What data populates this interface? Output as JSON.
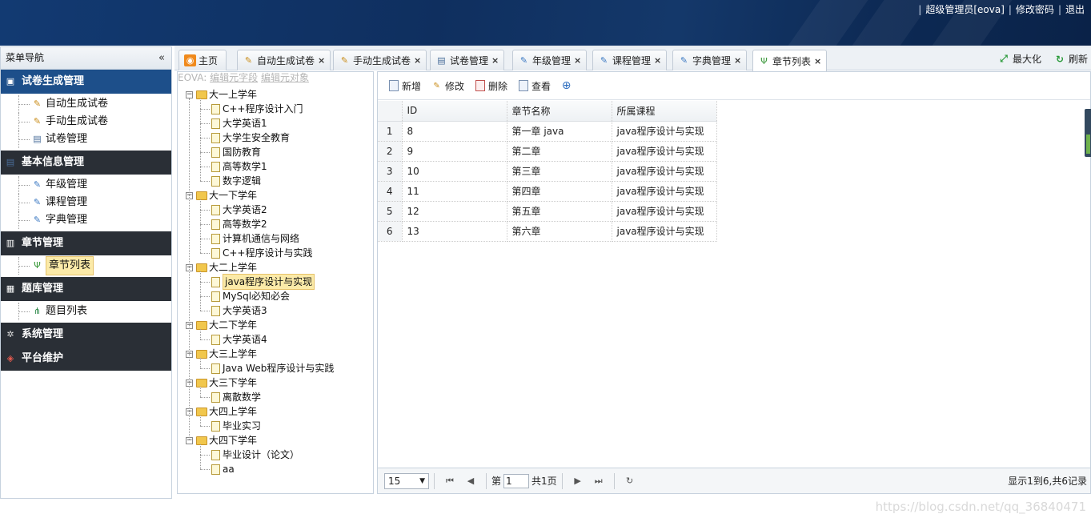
{
  "header": {
    "links": [
      "超级管理员[eova]",
      "修改密码",
      "退出"
    ]
  },
  "menu": {
    "title": "菜单导航",
    "collapse_icon": "«",
    "groups": [
      {
        "label": "试卷生成管理",
        "icon": "book-icon",
        "active": true,
        "items": [
          {
            "label": "自动生成试卷",
            "icon": "edit-icon"
          },
          {
            "label": "手动生成试卷",
            "icon": "edit-icon"
          },
          {
            "label": "试卷管理",
            "icon": "form-icon"
          }
        ]
      },
      {
        "label": "基本信息管理",
        "icon": "form-icon",
        "items": [
          {
            "label": "年级管理",
            "icon": "form-edit-icon"
          },
          {
            "label": "课程管理",
            "icon": "form-edit-icon"
          },
          {
            "label": "字典管理",
            "icon": "form-edit-icon"
          }
        ]
      },
      {
        "label": "章节管理",
        "icon": "list-icon",
        "items": [
          {
            "label": "章节列表",
            "icon": "tree-icon",
            "selected": true
          }
        ]
      },
      {
        "label": "题库管理",
        "icon": "table-icon",
        "items": [
          {
            "label": "题目列表",
            "icon": "org-icon"
          }
        ]
      },
      {
        "label": "系统管理",
        "icon": "gear-icon",
        "items": []
      },
      {
        "label": "平台维护",
        "icon": "cubes-icon",
        "items": []
      }
    ]
  },
  "tabs": [
    {
      "label": "主页",
      "icon": "rss-icon",
      "closable": false
    },
    {
      "label": "自动生成试卷",
      "icon": "edit-icon",
      "closable": true
    },
    {
      "label": "手动生成试卷",
      "icon": "edit-icon",
      "closable": true
    },
    {
      "label": "试卷管理",
      "icon": "form-icon",
      "closable": true
    },
    {
      "label": "年级管理",
      "icon": "form-edit-icon",
      "closable": true
    },
    {
      "label": "课程管理",
      "icon": "form-edit-icon",
      "closable": true
    },
    {
      "label": "字典管理",
      "icon": "form-edit-icon",
      "closable": true
    },
    {
      "label": "章节列表",
      "icon": "tree-icon",
      "closable": true,
      "active": true
    }
  ],
  "tab_tools": {
    "maximize": "最大化",
    "refresh": "刷新"
  },
  "tree": {
    "links": {
      "prefix": "EOVA:",
      "edit_fields": "编辑元字段",
      "edit_object": "编辑元对象"
    },
    "nodes": [
      {
        "label": "大一上学年",
        "children": [
          "C++程序设计入门",
          "大学英语1",
          "大学生安全教育",
          "国防教育",
          "高等数学1",
          "数字逻辑"
        ]
      },
      {
        "label": "大一下学年",
        "children": [
          "大学英语2",
          "高等数学2",
          "计算机通信与网络",
          "C++程序设计与实践"
        ]
      },
      {
        "label": "大二上学年",
        "children": [
          "java程序设计与实现",
          "MySql必知必会",
          "大学英语3"
        ],
        "selected_child": 0
      },
      {
        "label": "大二下学年",
        "children": [
          "大学英语4"
        ]
      },
      {
        "label": "大三上学年",
        "children": [
          "Java Web程序设计与实践"
        ]
      },
      {
        "label": "大三下学年",
        "children": [
          "离散数学"
        ]
      },
      {
        "label": "大四上学年",
        "children": [
          "毕业实习"
        ]
      },
      {
        "label": "大四下学年",
        "children": [
          "毕业设计（论文）",
          "aa"
        ]
      }
    ]
  },
  "grid": {
    "toolbar": {
      "add": "新增",
      "edit": "修改",
      "delete": "删除",
      "view": "查看"
    },
    "columns": [
      "ID",
      "章节名称",
      "所属课程"
    ],
    "rows": [
      {
        "n": "1",
        "id": "8",
        "name": "第一章 java",
        "course": "java程序设计与实现"
      },
      {
        "n": "2",
        "id": "9",
        "name": "第二章",
        "course": "java程序设计与实现"
      },
      {
        "n": "3",
        "id": "10",
        "name": "第三章",
        "course": "java程序设计与实现"
      },
      {
        "n": "4",
        "id": "11",
        "name": "第四章",
        "course": "java程序设计与实现"
      },
      {
        "n": "5",
        "id": "12",
        "name": "第五章",
        "course": "java程序设计与实现"
      },
      {
        "n": "6",
        "id": "13",
        "name": "第六章",
        "course": "java程序设计与实现"
      }
    ],
    "pager": {
      "page_size": "15",
      "page_prefix": "第",
      "page_value": "1",
      "page_total": "共1页",
      "info": "显示1到6,共6记录"
    }
  },
  "watermark": "https://blog.csdn.net/qq_36840471"
}
